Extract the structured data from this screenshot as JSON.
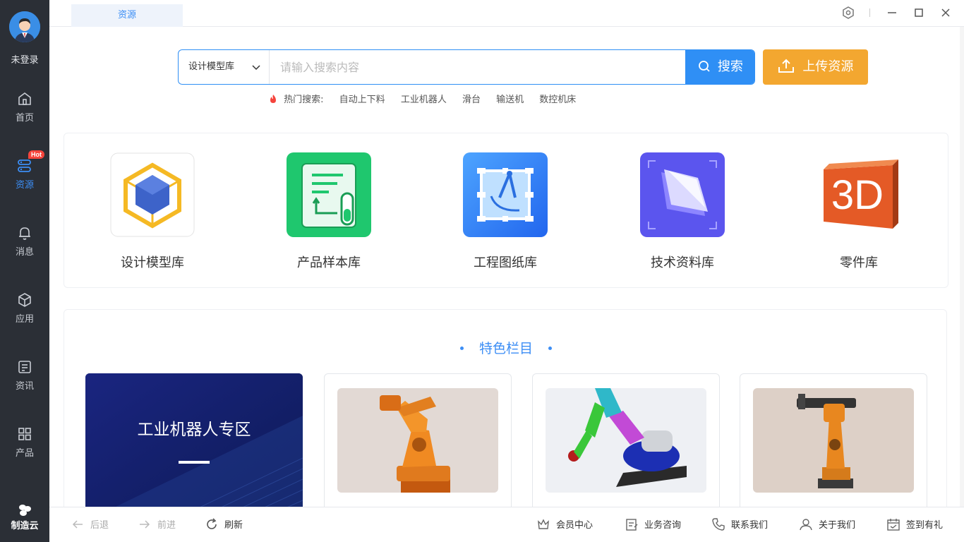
{
  "sidebar": {
    "login_label": "未登录",
    "items": [
      {
        "label": "首页",
        "icon": "home-icon"
      },
      {
        "label": "资源",
        "icon": "resource-icon",
        "badge": "Hot",
        "active": true
      },
      {
        "label": "消息",
        "icon": "bell-icon"
      },
      {
        "label": "应用",
        "icon": "cube-icon"
      },
      {
        "label": "资讯",
        "icon": "news-icon"
      },
      {
        "label": "产品",
        "icon": "grid-icon"
      }
    ],
    "brand": "制造云"
  },
  "topbar": {
    "tab_label": "资源",
    "icons": [
      "settings-hex-icon",
      "minimize-icon",
      "maximize-icon",
      "close-icon"
    ]
  },
  "search": {
    "category": "设计模型库",
    "placeholder": "请输入搜索内容",
    "button_label": "搜索",
    "upload_label": "上传资源"
  },
  "hot_search": {
    "title": "热门搜索:",
    "terms": [
      "自动上下料",
      "工业机器人",
      "滑台",
      "输送机",
      "数控机床"
    ]
  },
  "categories": [
    {
      "label": "设计模型库",
      "icon": "design-model-icon"
    },
    {
      "label": "产品样本库",
      "icon": "product-sample-icon"
    },
    {
      "label": "工程图纸库",
      "icon": "engineering-drawing-icon"
    },
    {
      "label": "技术资料库",
      "icon": "tech-docs-icon"
    },
    {
      "label": "零件库",
      "icon": "parts-3d-icon"
    }
  ],
  "featured": {
    "title": "特色栏目",
    "banner_text": "工业机器人专区"
  },
  "bottombar": {
    "back": "后退",
    "forward": "前进",
    "refresh": "刷新",
    "member": "会员中心",
    "consult": "业务咨询",
    "contact": "联系我们",
    "about": "关于我们",
    "checkin": "签到有礼"
  },
  "colors": {
    "accent": "#2f8ff5",
    "upload": "#f3a730",
    "sidebar_bg": "#2b2f36",
    "hot_badge": "#f5443c"
  }
}
